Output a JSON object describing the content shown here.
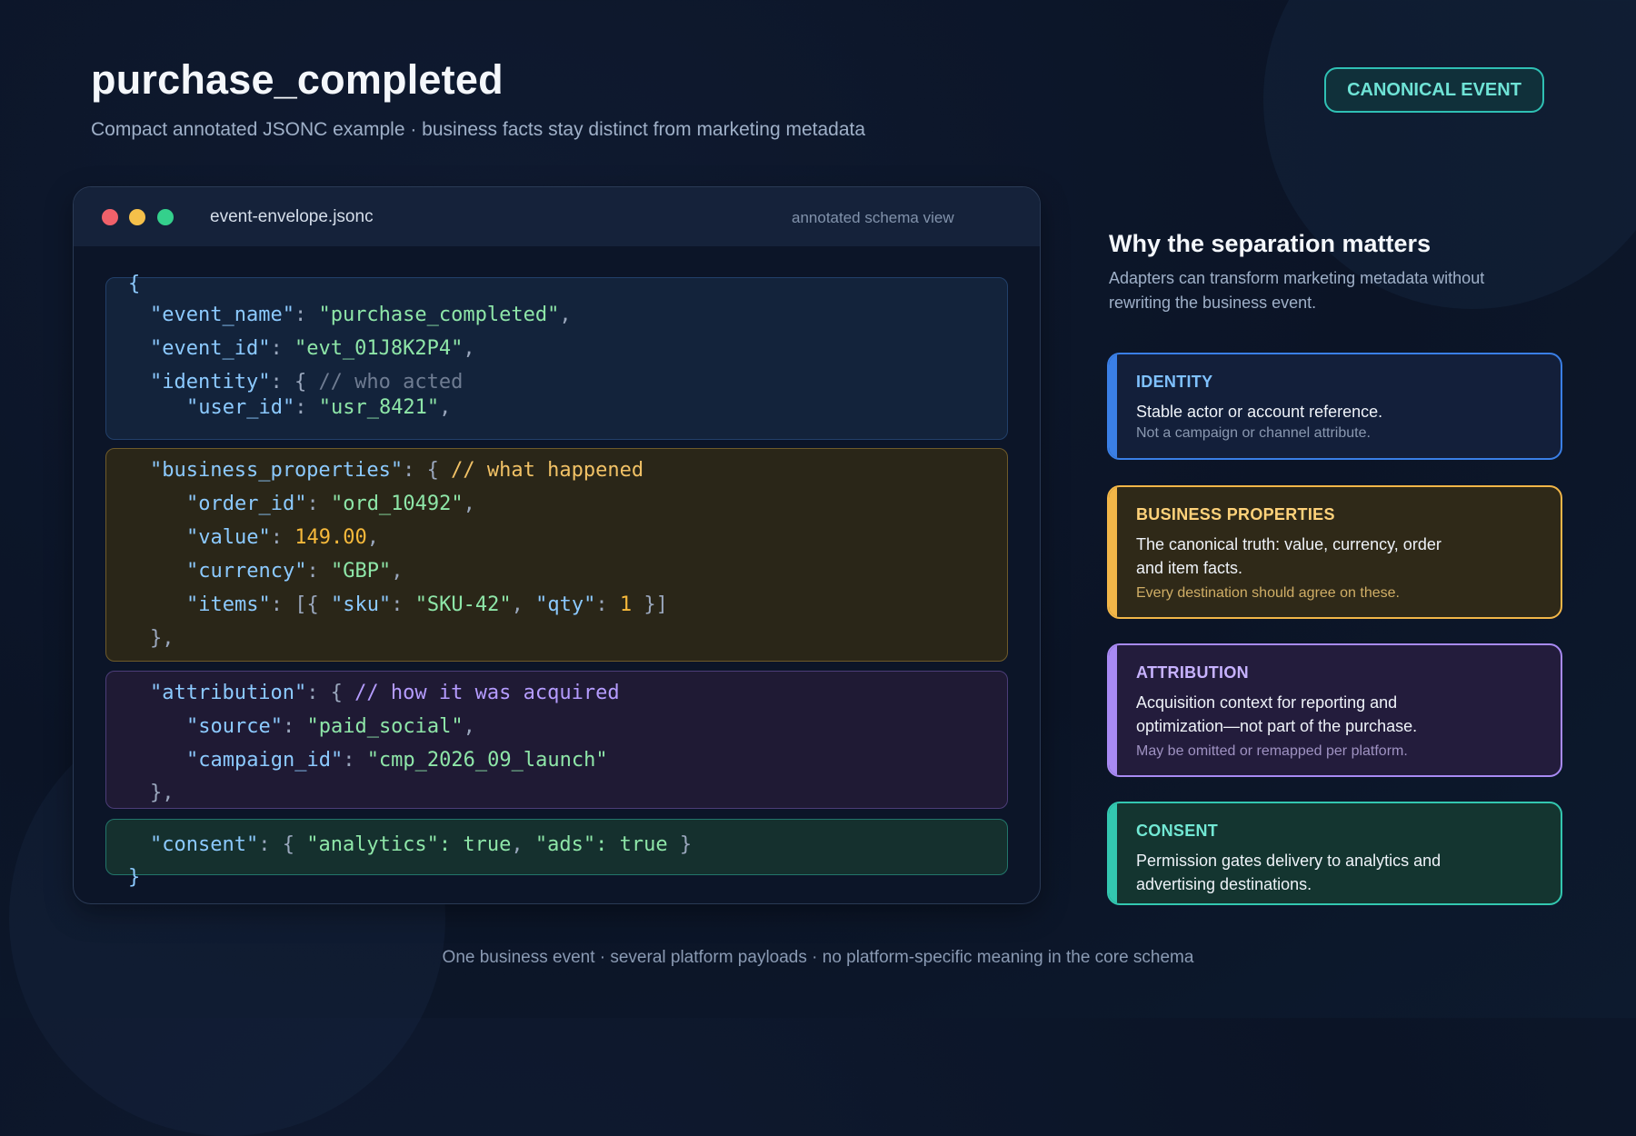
{
  "header": {
    "title": "purchase_completed",
    "subtitle": "Compact annotated JSONC example · business facts stay distinct from marketing metadata",
    "badge": "CANONICAL EVENT"
  },
  "editor": {
    "file_name": "event-envelope.jsonc",
    "view_label": "annotated schema view"
  },
  "code": {
    "open_brace": "{",
    "close_brace": "}",
    "event_name": {
      "key": "\"event_name\"",
      "value": "\"purchase_completed\""
    },
    "event_id": {
      "key": "\"event_id\"",
      "value": "\"evt_01J8K2P4\""
    },
    "identity": {
      "key": "\"identity\"",
      "comment": "// who acted"
    },
    "user_id": {
      "key": "\"user_id\"",
      "value": "\"usr_8421\""
    },
    "business_properties": {
      "key": "\"business_properties\"",
      "comment": "// what happened"
    },
    "order_id": {
      "key": "\"order_id\"",
      "value": "\"ord_10492\""
    },
    "value": {
      "key": "\"value\"",
      "value": "149.00"
    },
    "currency": {
      "key": "\"currency\"",
      "value": "\"GBP\""
    },
    "items": {
      "key": "\"items\"",
      "sku_key": "\"sku\"",
      "sku_value": "\"SKU-42\"",
      "qty_key": "\"qty\"",
      "qty_value": "1"
    },
    "attribution": {
      "key": "\"attribution\"",
      "comment": "// how it was acquired"
    },
    "source": {
      "key": "\"source\"",
      "value": "\"paid_social\""
    },
    "campaign_id": {
      "key": "\"campaign_id\"",
      "value": "\"cmp_2026_09_launch\""
    },
    "consent": {
      "key": "\"consent\"",
      "analytics_key": "\"analytics\"",
      "analytics_value": "true",
      "ads_key": "\"ads\"",
      "ads_value": "true"
    }
  },
  "sidebar": {
    "title": "Why the separation matters",
    "description": "Adapters can transform marketing metadata without rewriting the business event.",
    "cards": [
      {
        "title": "IDENTITY",
        "body": "Stable actor or account reference.",
        "note": "Not a campaign or channel attribute.",
        "color": "#3a7fe6"
      },
      {
        "title": "BUSINESS PROPERTIES",
        "body": "The canonical truth: value, currency, order and item facts.",
        "note": "Every destination should agree on these.",
        "color": "#f2b648"
      },
      {
        "title": "ATTRIBUTION",
        "body": "Acquisition context for reporting and optimization—not part of the purchase.",
        "note": "May be omitted or remapped per platform.",
        "color": "#a88af3"
      },
      {
        "title": "CONSENT",
        "body": "Permission gates delivery to analytics and advertising destinations.",
        "color": "#33c7b0"
      }
    ]
  },
  "footer": "One business event · several platform payloads · no platform-specific meaning in the core schema"
}
